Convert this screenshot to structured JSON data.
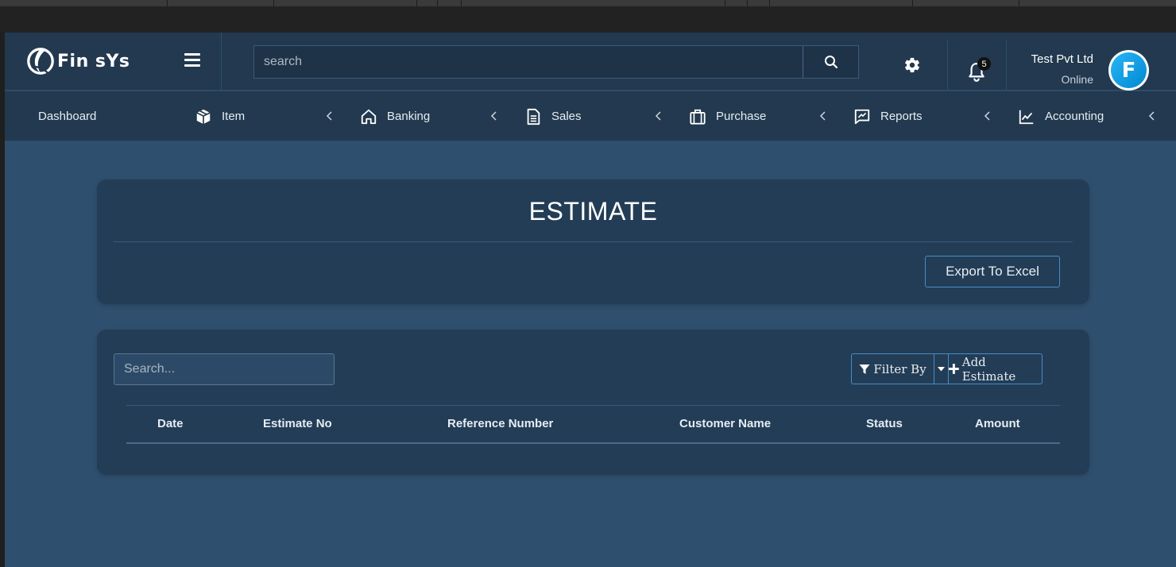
{
  "brand": {
    "name": "Fin sYs"
  },
  "header": {
    "search_placeholder": "search",
    "notifications_count": "5",
    "company_name": "Test Pvt Ltd",
    "company_status": "Online",
    "avatar_letter": "F"
  },
  "nav": {
    "items": [
      {
        "label": "Dashboard",
        "icon": "none"
      },
      {
        "label": "Item",
        "icon": "box-icon"
      },
      {
        "label": "Banking",
        "icon": "home-icon"
      },
      {
        "label": "Sales",
        "icon": "document-icon"
      },
      {
        "label": "Purchase",
        "icon": "briefcase-icon"
      },
      {
        "label": "Reports",
        "icon": "chart-message-icon"
      },
      {
        "label": "Accounting",
        "icon": "line-chart-icon"
      }
    ]
  },
  "estimate": {
    "title": "ESTIMATE",
    "export_label": "Export To Excel"
  },
  "table": {
    "search_placeholder": "Search...",
    "filter_label": "Filter By",
    "add_label": "Add Estimate",
    "columns": [
      "Date",
      "Estimate No",
      "Reference Number",
      "Customer Name",
      "Status",
      "Amount"
    ],
    "rows": []
  },
  "colors": {
    "page_bg": "#2e4f6e",
    "panel_bg": "#233d56",
    "header_bg": "#22394f",
    "accent": "#4a8bc9"
  }
}
